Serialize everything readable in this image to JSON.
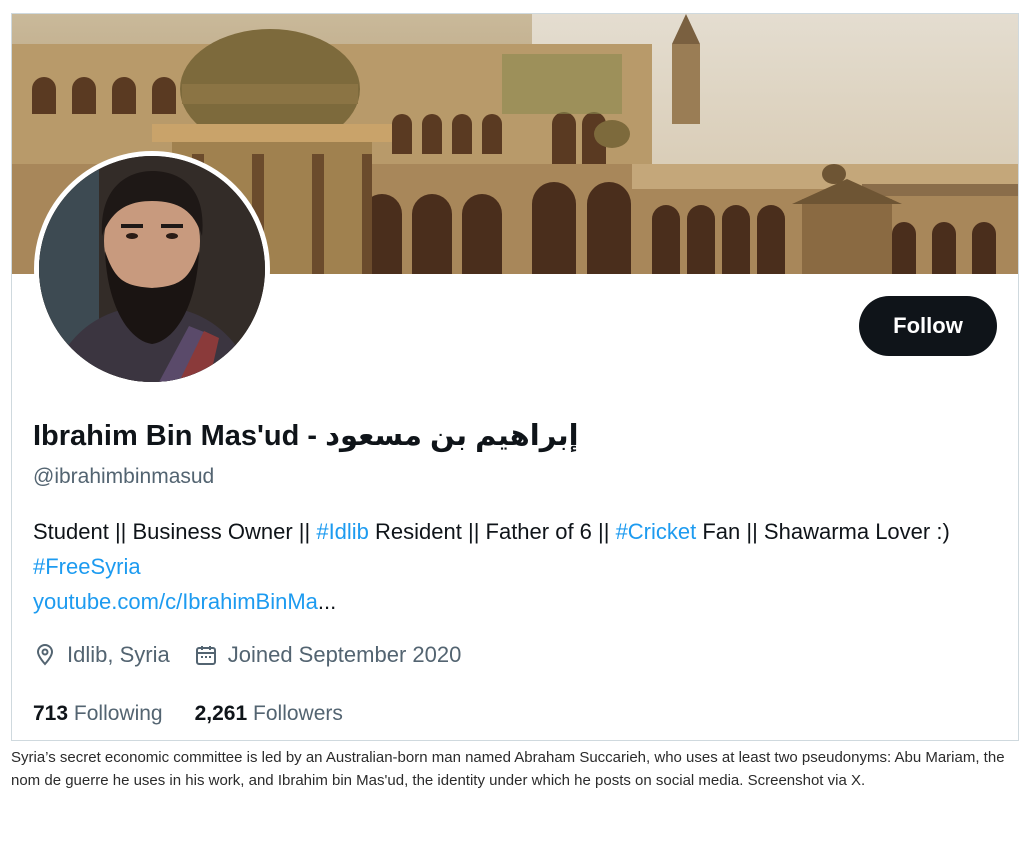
{
  "profile": {
    "display_name": "Ibrahim Bin Mas'ud - إبراهيم بن مسعود",
    "handle": "@ibrahimbinmasud",
    "follow_label": "Follow",
    "bio": {
      "t1": "Student || Business Owner || ",
      "tag1": "#Idlib",
      "t2": " Resident || Father of 6 || ",
      "tag2": "#Cricket",
      "t3": " Fan || Shawarma Lover :) ",
      "tag3": "#FreeSyria",
      "link": "youtube.com/c/IbrahimBinMa",
      "ellipsis": "..."
    },
    "location": "Idlib, Syria",
    "joined": "Joined September 2020",
    "following_count": "713",
    "following_label": "Following",
    "followers_count": "2,261",
    "followers_label": "Followers"
  },
  "icons": {
    "location": "location-pin-icon",
    "joined": "calendar-icon"
  },
  "colors": {
    "accent": "#1d9bf0",
    "button_bg": "#0f1419",
    "secondary_text": "#536471"
  },
  "caption": "Syria’s secret economic committee is led by an Australian-born man named Abraham Succarieh, who uses at least two pseudonyms: Abu Mariam, the nom de guerre he uses in his work, and Ibrahim bin Mas'ud, the identity under which he posts on social media. Screenshot via X."
}
